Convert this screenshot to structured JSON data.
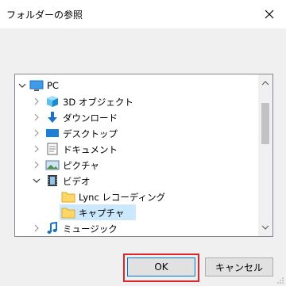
{
  "dialog": {
    "title": "フォルダーの参照"
  },
  "tree": {
    "items": [
      {
        "label": "PC",
        "icon": "pc-icon"
      },
      {
        "label": "3D オブジェクト",
        "icon": "3d-objects-icon"
      },
      {
        "label": "ダウンロード",
        "icon": "download-icon"
      },
      {
        "label": "デスクトップ",
        "icon": "desktop-icon"
      },
      {
        "label": "ドキュメント",
        "icon": "documents-icon"
      },
      {
        "label": "ピクチャ",
        "icon": "pictures-icon"
      },
      {
        "label": "ビデオ",
        "icon": "video-icon"
      },
      {
        "label": "Lync レコーディング",
        "icon": "folder-icon"
      },
      {
        "label": "キャプチャ",
        "icon": "folder-icon",
        "selected": true
      },
      {
        "label": "ミュージック",
        "icon": "music-icon"
      }
    ]
  },
  "buttons": {
    "ok": "OK",
    "cancel": "キャンセル"
  },
  "colors": {
    "selection": "#cce8ff",
    "highlight_border": "#e0242b",
    "folder": "#ffd766"
  }
}
